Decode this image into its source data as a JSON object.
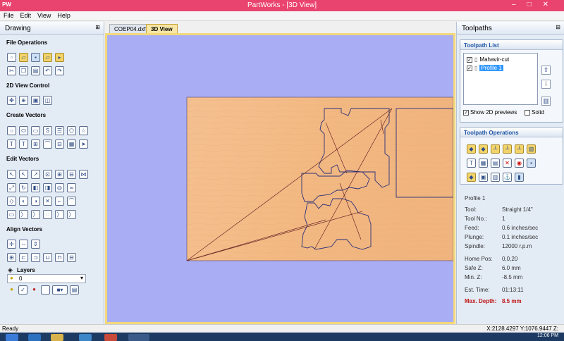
{
  "window": {
    "app_icon": "PW",
    "title": "PartWorks - [3D View]",
    "controls": [
      "–",
      "□",
      "✕"
    ]
  },
  "menu": [
    "File",
    "Edit",
    "View",
    "Help"
  ],
  "left_panel": {
    "title": "Drawing",
    "pin": "⊞",
    "sections": {
      "file_operations": "File Operations",
      "view_control": "2D View Control",
      "create_vectors": "Create Vectors",
      "edit_vectors": "Edit Vectors",
      "align_vectors": "Align Vectors",
      "layers": "Layers"
    },
    "layer_value": "0"
  },
  "tabs": [
    {
      "label": "COEP04.dxf",
      "active": false
    },
    {
      "label": "3D View",
      "active": true
    }
  ],
  "right_panel": {
    "title": "Toolpaths",
    "pin": "⊞",
    "toolpath_list_title": "Toolpath List",
    "toolpaths": [
      {
        "name": "Mahavir-cut",
        "checked": true,
        "selected": false
      },
      {
        "name": "Profile 1",
        "checked": true,
        "selected": true
      }
    ],
    "show_2d_previews_label": "Show 2D previews",
    "show_2d_previews_checked": true,
    "solid_label": "Solid",
    "solid_checked": false,
    "operations_title": "Toolpath Operations",
    "details": {
      "name": "Profile 1",
      "rows": [
        {
          "label": "Tool:",
          "value": "Straight 1/4\""
        },
        {
          "label": "Tool No.:",
          "value": "1"
        },
        {
          "label": "Feed:",
          "value": "0.6 inches/sec"
        },
        {
          "label": "Plunge:",
          "value": "0.1 inches/sec"
        },
        {
          "label": "Spindle:",
          "value": "12000 r.p.m"
        },
        {
          "label": "Home Pos:",
          "value": "0,0,20"
        },
        {
          "label": "Safe Z:",
          "value": "6.0 mm"
        },
        {
          "label": "Min. Z:",
          "value": "-8.5 mm"
        },
        {
          "label": "Est. Time:",
          "value": "01:13:11"
        },
        {
          "label": "Max. Depth:",
          "value": "8.5 mm"
        }
      ]
    }
  },
  "status": {
    "left": "Ready",
    "right": "X:2128.4297 Y:1076.9447 Z:"
  },
  "taskbar": {
    "clock": "12:06 PM"
  },
  "colors": {
    "titlebar": "#e9446f",
    "view_bg": "#a9aef4",
    "board": "#f2b986",
    "toolpath": "#2a2f7a"
  }
}
